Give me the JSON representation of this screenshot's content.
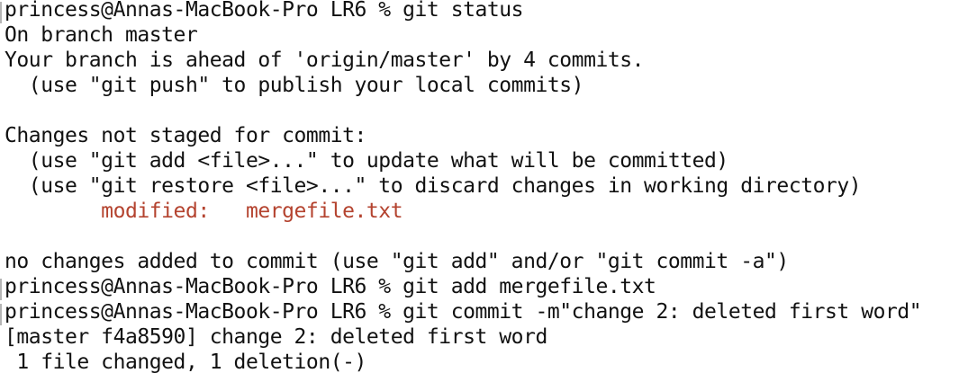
{
  "terminal": {
    "colors": {
      "background": "#ffffff",
      "text": "#111111",
      "modified": "#b4432f",
      "cursor_mark": "#b5b5b5"
    },
    "lines": [
      "princess@Annas-MacBook-Pro LR6 % git status",
      "On branch master",
      "Your branch is ahead of 'origin/master' by 4 commits.",
      "  (use \"git push\" to publish your local commits)",
      "",
      "Changes not staged for commit:",
      "  (use \"git add <file>...\" to update what will be committed)",
      "  (use \"git restore <file>...\" to discard changes in working directory)",
      "        modified:   mergefile.txt",
      "",
      "no changes added to commit (use \"git add\" and/or \"git commit -a\")",
      "princess@Annas-MacBook-Pro LR6 % git add mergefile.txt",
      "princess@Annas-MacBook-Pro LR6 % git commit -m\"change 2: deleted first word\"",
      "[master f4a8590] change 2: deleted first word",
      " 1 file changed, 1 deletion(-)"
    ]
  }
}
